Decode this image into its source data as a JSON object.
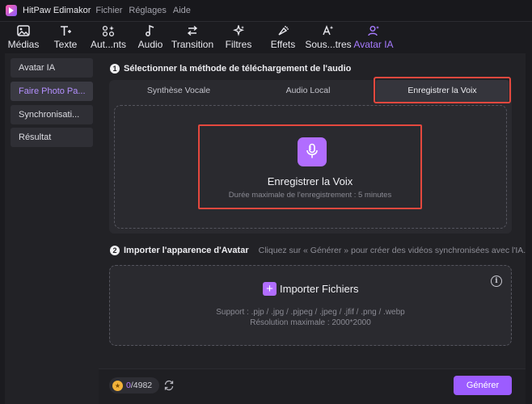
{
  "app": {
    "title": "HitPaw Edimakor"
  },
  "menu": [
    "Fichier",
    "Réglages",
    "Aide"
  ],
  "toolbar": {
    "items": [
      {
        "label": "Médias",
        "icon": "image-icon"
      },
      {
        "label": "Texte",
        "icon": "text-icon"
      },
      {
        "label": "Aut...nts",
        "icon": "sparkle-grid-icon"
      },
      {
        "label": "Audio",
        "icon": "music-note-icon"
      },
      {
        "label": "Transition",
        "icon": "transition-arrows-icon"
      },
      {
        "label": "Filtres",
        "icon": "filter-sparkle-icon"
      },
      {
        "label": "Effets",
        "icon": "effects-icon"
      },
      {
        "label": "Sous...tres",
        "icon": "subtitles-icon"
      },
      {
        "label": "Avatar IA",
        "icon": "avatar-icon"
      }
    ],
    "active": "Avatar IA",
    "accent": "#a77bff"
  },
  "sidebar": {
    "items": [
      {
        "label": "Avatar IA"
      },
      {
        "label": "Faire Photo Pa..."
      },
      {
        "label": "Synchronisati..."
      },
      {
        "label": "Résultat"
      }
    ],
    "active_index": 1
  },
  "step1": {
    "number": "1",
    "title": "Sélectionner la méthode de téléchargement de l'audio",
    "tabs": [
      "Synthèse Vocale",
      "Audio Local",
      "Enregistrer la Voix"
    ],
    "active_tab": "Enregistrer la Voix",
    "record": {
      "title": "Enregistrer la Voix",
      "subtitle": "Durée maximale de l'enregistrement : 5 minutes"
    }
  },
  "step2": {
    "number": "2",
    "title": "Importer l'apparence d'Avatar",
    "hint": "Cliquez sur « Générer » pour créer des vidéos synchronisées avec l'IA.",
    "import_label": "Importer Fichiers",
    "support": "Support : .pjp / .jpg / .pjpeg / .jpeg / .jfif / .png / .webp",
    "resolution": "Résolution maximale : 2000*2000",
    "info_glyph": "i"
  },
  "footer": {
    "credits_used": "0",
    "credits_total": "/4982",
    "generate_label": "Générer"
  },
  "colors": {
    "highlight": "#e5483e",
    "primary": "#9c5cff",
    "mic_bg": "#b16dff",
    "background": "#1b1b1f",
    "panel": "#222226"
  }
}
